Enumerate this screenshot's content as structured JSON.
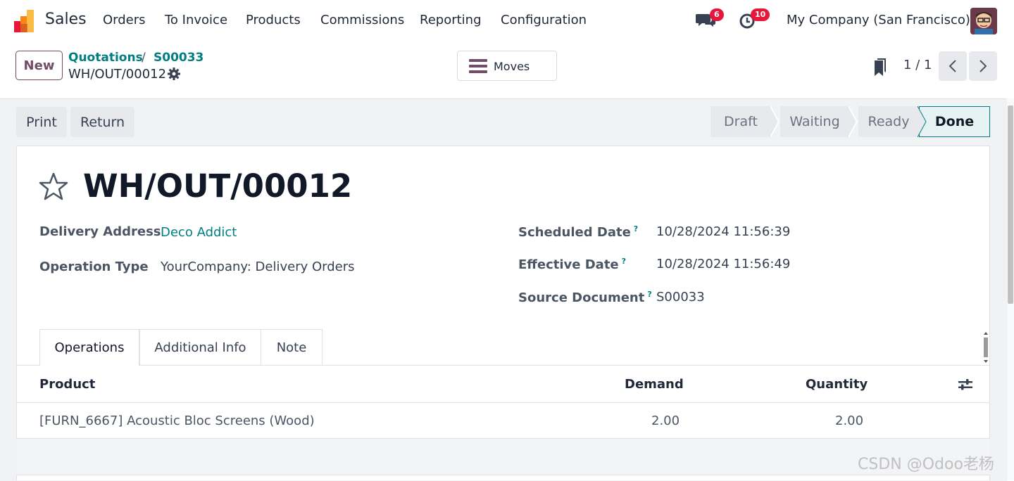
{
  "nav": {
    "app_name": "Sales",
    "menu": [
      "Orders",
      "To Invoice",
      "Products",
      "Commissions",
      "Reporting",
      "Configuration"
    ],
    "messages_count": "6",
    "activities_count": "10",
    "company": "My Company (San Francisco)"
  },
  "control": {
    "new_label": "New",
    "breadcrumb": [
      "Quotations",
      "S00033"
    ],
    "breadcrumb_sep": "/",
    "record_name": "WH/OUT/00012",
    "smart_button": "Moves",
    "pager": "1 / 1"
  },
  "actions": {
    "print": "Print",
    "return": "Return"
  },
  "statusbar": {
    "stages": [
      "Draft",
      "Waiting",
      "Ready",
      "Done"
    ],
    "current": "Done"
  },
  "form": {
    "title": "WH/OUT/00012",
    "delivery_address_label": "Delivery Address",
    "delivery_address": "Deco Addict",
    "operation_type_label": "Operation Type",
    "operation_type": "YourCompany: Delivery Orders",
    "scheduled_date_label": "Scheduled Date",
    "scheduled_date": "10/28/2024 11:56:39",
    "effective_date_label": "Effective Date",
    "effective_date": "10/28/2024 11:56:49",
    "source_document_label": "Source Document",
    "source_document": "S00033",
    "help_mark": "?"
  },
  "tabs": [
    "Operations",
    "Additional Info",
    "Note"
  ],
  "table": {
    "headers": {
      "product": "Product",
      "demand": "Demand",
      "quantity": "Quantity"
    },
    "rows": [
      {
        "product": "[FURN_6667] Acoustic Bloc Screens (Wood)",
        "demand": "2.00",
        "quantity": "2.00"
      }
    ]
  },
  "watermark": "CSDN @Odoo老杨",
  "colors": {
    "accent": "#714b67",
    "link": "#017e84",
    "badge": "#e6173b"
  }
}
